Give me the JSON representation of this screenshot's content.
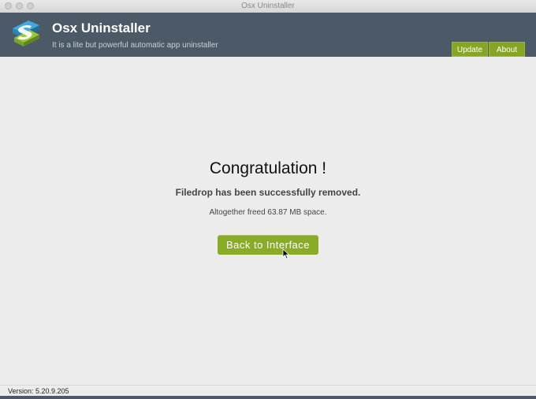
{
  "window": {
    "title": "Osx Uninstaller"
  },
  "header": {
    "app_title": "Osx Uninstaller",
    "subtitle": "It is a lite but powerful automatic app uninstaller",
    "update_label": "Update",
    "about_label": "About",
    "logo_icon": "osx-uninstaller-logo-icon"
  },
  "result": {
    "heading": "Congratulation !",
    "removed_message": "Filedrop has been successfully removed.",
    "freed_message": "Altogether freed 63.87 MB space.",
    "back_button_label": "Back to Interface"
  },
  "footer": {
    "version": "Version: 5.20.9.205"
  },
  "colors": {
    "header_bg": "#4b5a66",
    "accent_green": "#8aab26"
  }
}
